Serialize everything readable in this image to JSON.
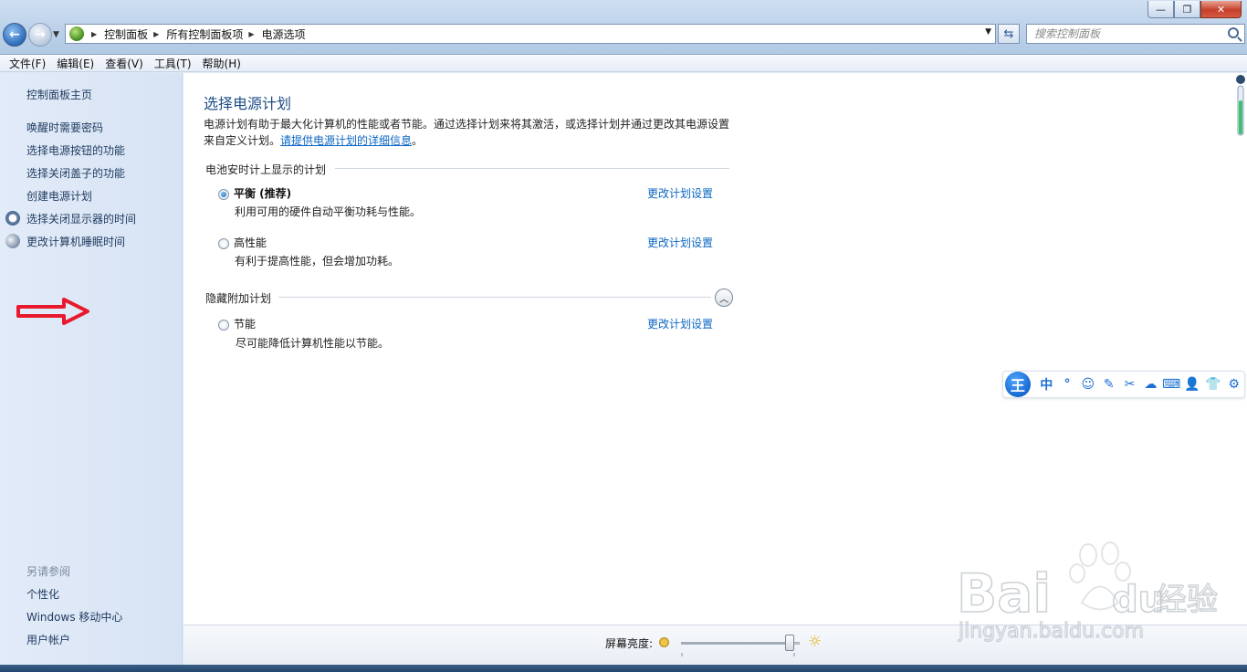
{
  "window": {
    "buttons": {
      "minimize": "—",
      "maximize": "❐",
      "close": "✕"
    }
  },
  "address": {
    "crumbs": [
      "控制面板",
      "所有控制面板项",
      "电源选项"
    ],
    "search_placeholder": "搜索控制面板"
  },
  "menu": [
    "文件(F)",
    "编辑(E)",
    "查看(V)",
    "工具(T)",
    "帮助(H)"
  ],
  "sidebar": {
    "home": "控制面板主页",
    "links": [
      "唤醒时需要密码",
      "选择电源按钮的功能",
      "选择关闭盖子的功能",
      "创建电源计划",
      "选择关闭显示器的时间",
      "更改计算机睡眠时间"
    ],
    "see_also_heading": "另请参阅",
    "see_also": [
      "个性化",
      "Windows 移动中心",
      "用户帐户"
    ]
  },
  "main": {
    "title": "选择电源计划",
    "intro_line1": "电源计划有助于最大化计算机的性能或者节能。通过选择计划来将其激活，或选择计划并通过更改其电源设置",
    "intro_line2_prefix": "来自定义计划。",
    "intro_link": "请提供电源计划的详细信息",
    "intro_suffix": "。",
    "battery_group": "电池安时计上显示的计划",
    "hidden_group": "隐藏附加计划",
    "plans": [
      {
        "name": "平衡 (推荐)",
        "desc": "利用可用的硬件自动平衡功耗与性能。",
        "link": "更改计划设置",
        "selected": true
      },
      {
        "name": "高性能",
        "desc": "有利于提高性能，但会增加功耗。",
        "link": "更改计划设置",
        "selected": false
      },
      {
        "name": "节能",
        "desc": "尽可能降低计算机性能以节能。",
        "link": "更改计划设置",
        "selected": false
      }
    ]
  },
  "ime": {
    "logo": "王",
    "items": [
      "中",
      "°",
      "☺",
      "✎",
      "✂",
      "☁",
      "⌨",
      "👤",
      "👕",
      "⚙"
    ]
  },
  "bottom": {
    "brightness_label": "屏幕亮度:",
    "brightness_level": 0.96
  },
  "watermark": {
    "brand": "Bai",
    "brand2": "du",
    "suffix": "经验",
    "url": "jingyan.baidu.com"
  }
}
